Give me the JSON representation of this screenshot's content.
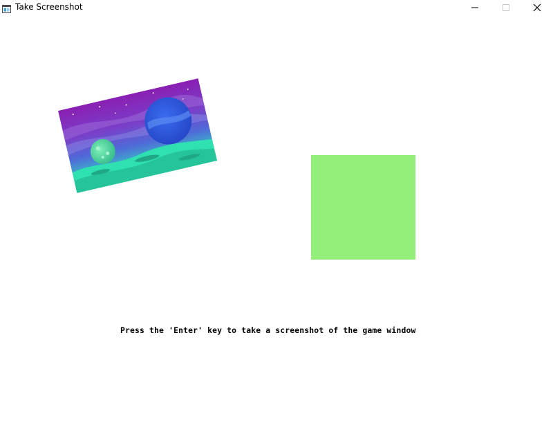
{
  "window": {
    "title": "Take Screenshot",
    "icon": "app-window-icon",
    "controls": {
      "minimize_icon": "minimize-icon",
      "maximize_icon": "maximize-icon",
      "close_icon": "close-icon"
    }
  },
  "game": {
    "background_color": "#ffffff",
    "sprite": {
      "name": "space-landscape-sprite",
      "colors": {
        "sky_top": "#8a1fb3",
        "sky_mid": "#5a57d6",
        "planet": "#2f5ee0",
        "moon": "#4fd39a",
        "ground": "#2fe0b0"
      }
    },
    "square": {
      "color": "#94ee7a"
    },
    "instruction": "Press the 'Enter' key to take a screenshot of the game window"
  }
}
